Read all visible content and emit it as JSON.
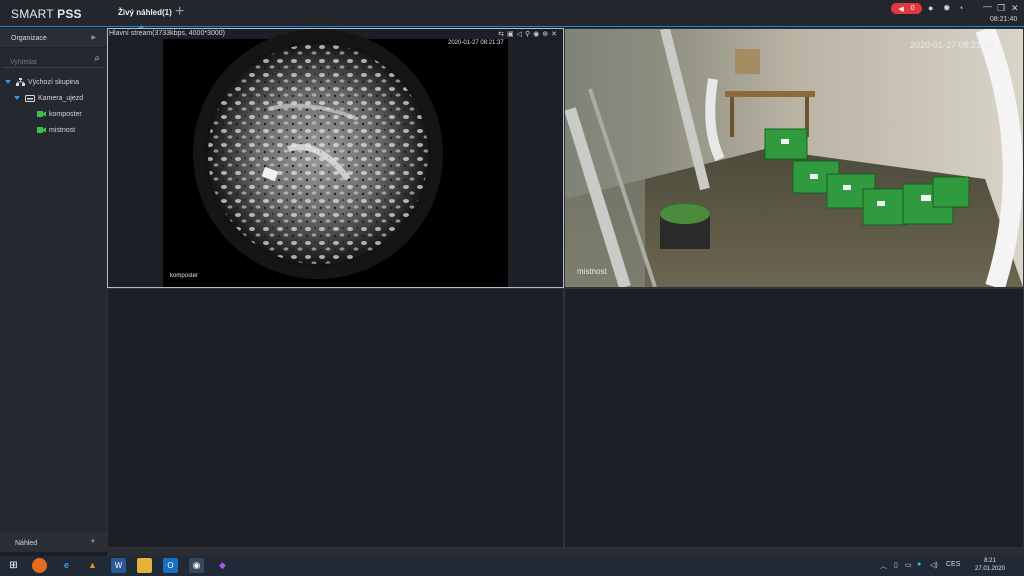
{
  "app": {
    "logo_prefix": "SMART ",
    "logo_bold": "PSS",
    "tab_label": "Živý náhled(1)",
    "tab_add": "+",
    "alarm_count": "0",
    "clock": "08:21:40"
  },
  "sidebar": {
    "header": "Organizace",
    "search_placeholder": "Vyhledat",
    "tree": [
      {
        "label": "Výchozí skupina",
        "level": 0
      },
      {
        "label": "Kamera_ujezd",
        "level": 1
      },
      {
        "label": "komposter",
        "level": 2
      },
      {
        "label": "mistnost",
        "level": 2
      }
    ],
    "bottom_panel": "Náhled"
  },
  "panes": [
    {
      "title": "Hlavní stream(3733kbps, 4000*3000)",
      "timestamp": "2020-01-27 08:21:37",
      "name": "komposter"
    },
    {
      "timestamp": "2020-01-27 08:21:40",
      "name": "mistnost"
    }
  ],
  "taskbar": {
    "lang": "CES",
    "time": "8:21",
    "date": "27.01.2020"
  },
  "colors": {
    "accent": "#2c84c8",
    "alarm": "#e0383e",
    "box_green": "#2f9a3e"
  }
}
